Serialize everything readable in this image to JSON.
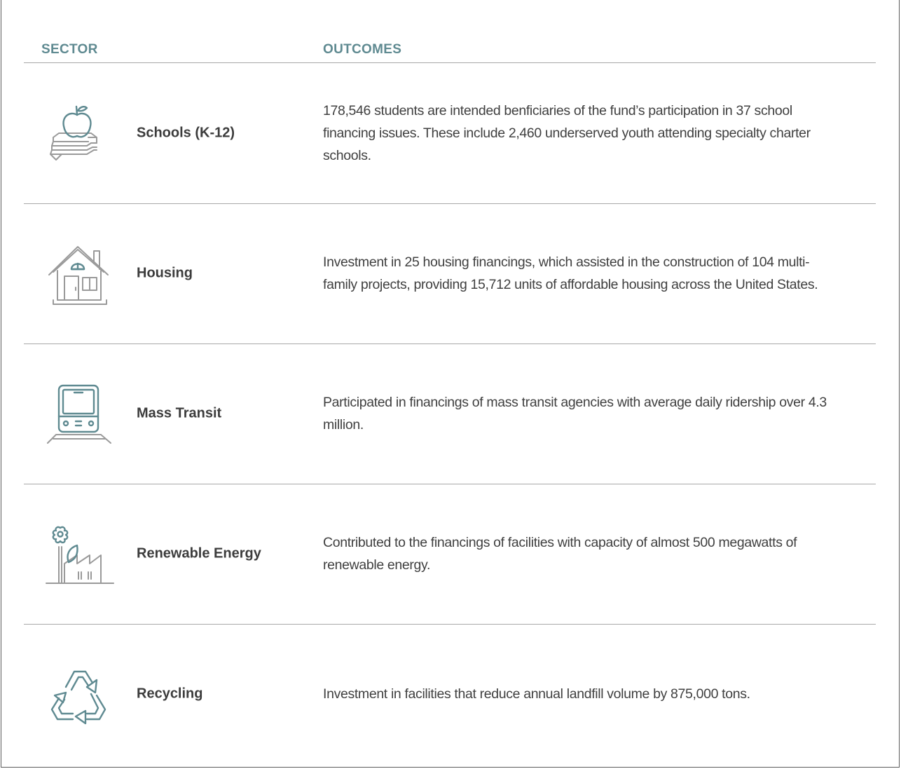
{
  "header": {
    "sector": "SECTOR",
    "outcomes": "OUTCOMES"
  },
  "colors": {
    "accent": "#5f8a91",
    "icon_gray": "#9a9a9a",
    "divider": "#a8a8a8"
  },
  "rows": [
    {
      "icon": "apple-books-icon",
      "sector": "Schools (K-12)",
      "outcome": "178,546 students are intended benficiaries of the fund’s participation in 37 school financing issues. These include 2,460 underserved youth attending specialty charter schools."
    },
    {
      "icon": "house-icon",
      "sector": "Housing",
      "outcome": "Investment in 25 housing financings, which assisted in the construction of 104 multi-family projects, providing 15,712 units of affordable housing across the United States."
    },
    {
      "icon": "train-icon",
      "sector": "Mass Transit",
      "outcome": "Participated in financings of mass transit agencies with average daily ridership over 4.3 million."
    },
    {
      "icon": "factory-flower-icon",
      "sector": "Renewable Energy",
      "outcome": "Contributed to the financings of facilities with capacity of almost 500 megawatts of renewable energy."
    },
    {
      "icon": "recycle-icon",
      "sector": "Recycling",
      "outcome": "Investment in facilities that reduce annual landfill volume by 875,000 tons."
    }
  ]
}
